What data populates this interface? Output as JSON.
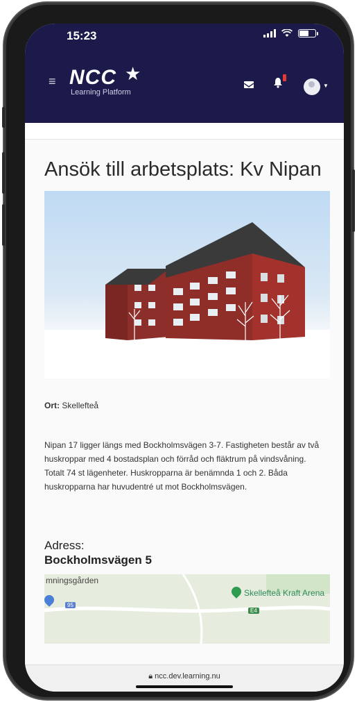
{
  "status_bar": {
    "time": "15:23",
    "battery_level": 0.6
  },
  "app_bar": {
    "menu_icon": "hamburger-icon",
    "logo_text": "NCC",
    "logo_subtitle": "Learning Platform",
    "icons": [
      "mail-icon",
      "bell-icon",
      "avatar",
      "chevron-down-icon"
    ]
  },
  "page": {
    "title": "Ansök till arbetsplats: Kv Nipan",
    "location_label": "Ort:",
    "location_value": "Skellefteå",
    "description": "Nipan 17 ligger längs med Bockholmsvägen 3-7. Fastigheten består av två huskroppar med 4 bostadsplan och förråd och fläktrum på vindsvåning. Totalt 74 st lägenheter. Huskropparna är benämnda 1 och 2. Båda huskropparna har huvudentré ut mot Bockholmsvägen.",
    "address_label": "Adress:",
    "address_value": "Bockholmsvägen 5"
  },
  "map": {
    "top_label": "mningsgården",
    "place_label": "Skellefteå Kraft Arena",
    "road_95": "95",
    "road_e4": "E4"
  },
  "browser": {
    "url": "ncc.dev.learning.nu"
  },
  "colors": {
    "header_bg": "#1b1a4a",
    "badge": "#e53935",
    "map_pin": "#2e9b4f"
  }
}
